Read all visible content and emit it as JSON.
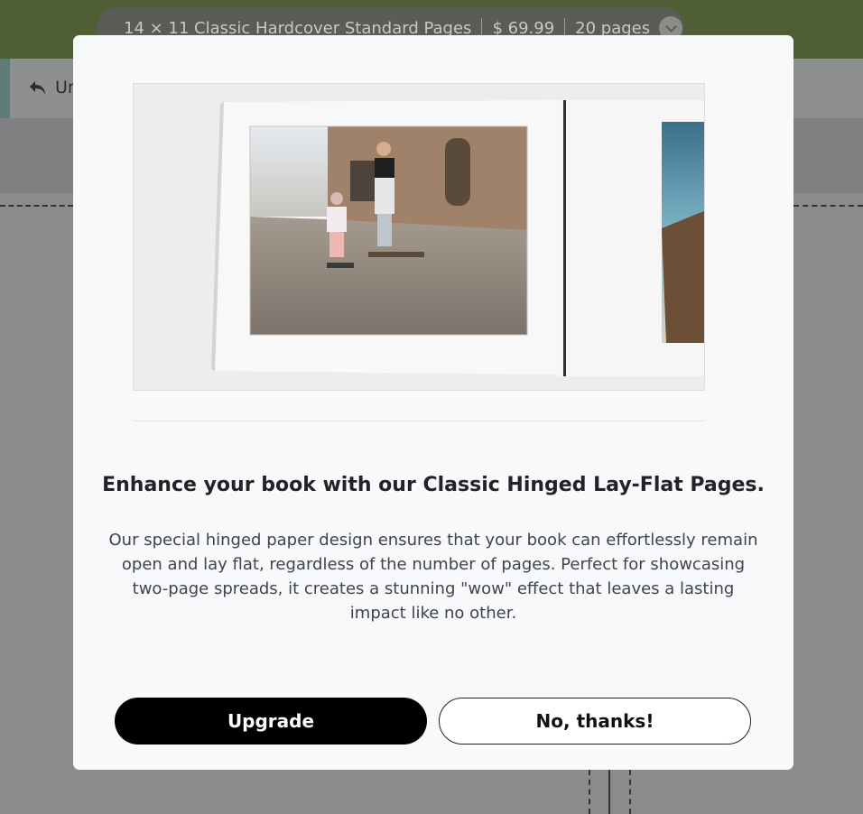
{
  "header": {
    "product_name": "14 × 11 Classic Hardcover Standard Pages",
    "price": "$ 69.99",
    "pages": "20 pages"
  },
  "toolbar": {
    "undo_label": "Un"
  },
  "modal": {
    "title": "Enhance your book with our Classic Hinged Lay-Flat Pages.",
    "body": "Our special hinged paper design ensures that your book can effortlessly remain open and lay flat, regardless of the number of pages. Perfect for showcasing two-page spreads, it creates a stunning \"wow\" effect that leaves a lasting impact like no other.",
    "upgrade_label": "Upgrade",
    "decline_label": "No, thanks!"
  },
  "colors": {
    "header_bg": "#4f5e34",
    "modal_bg": "#f7f9fb",
    "primary_button": "#000000"
  }
}
